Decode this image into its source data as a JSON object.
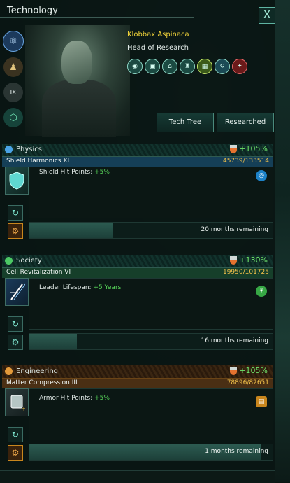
{
  "window": {
    "title": "Technology",
    "close_label": "X"
  },
  "sidebar": {
    "items": [
      {
        "name": "physics-tab-icon",
        "glyph": "⚛",
        "color": "#6aa8e6"
      },
      {
        "name": "ascension-tab-icon",
        "glyph": "♟",
        "color": "#c9a867"
      },
      {
        "name": "edict-tab-icon",
        "glyph": "Ⅸ",
        "color": "#b6c3c0"
      },
      {
        "name": "genetic-tab-icon",
        "glyph": "⬡",
        "color": "#53c69a"
      }
    ]
  },
  "scientist": {
    "name": "Klobbax Aspinaca",
    "role": "Head of Research"
  },
  "buttons": {
    "tech_tree": "Tech Tree",
    "researched": "Researched"
  },
  "sections": [
    {
      "name": "Physics",
      "pct": "+105%",
      "color": "#4aa3e6",
      "barcolor": "#153f57",
      "tech": "Shield Harmonics XI",
      "progress_text": "45739/133514",
      "effect_label": "Shield Hit Points:",
      "effect_value": "+5%",
      "remaining": "20 months remaining",
      "progress": 0.343,
      "corner_color": "#1d82c8"
    },
    {
      "name": "Society",
      "pct": "+130%",
      "color": "#4cc864",
      "barcolor": "#163f2a",
      "tech": "Cell Revitalization VI",
      "progress_text": "19950/101725",
      "effect_label": "Leader Lifespan:",
      "effect_value": "+5 Years",
      "remaining": "16 months remaining",
      "progress": 0.196,
      "corner_color": "#37a845"
    },
    {
      "name": "Engineering",
      "pct": "+105%",
      "color": "#e39a3a",
      "barcolor": "#4a2f14",
      "tech": "Matter Compression III",
      "progress_text": "78896/82651",
      "effect_label": "Armor Hit Points:",
      "effect_value": "+5%",
      "remaining": "1 months remaining",
      "progress": 0.955,
      "corner_color": "#c9861d"
    }
  ]
}
